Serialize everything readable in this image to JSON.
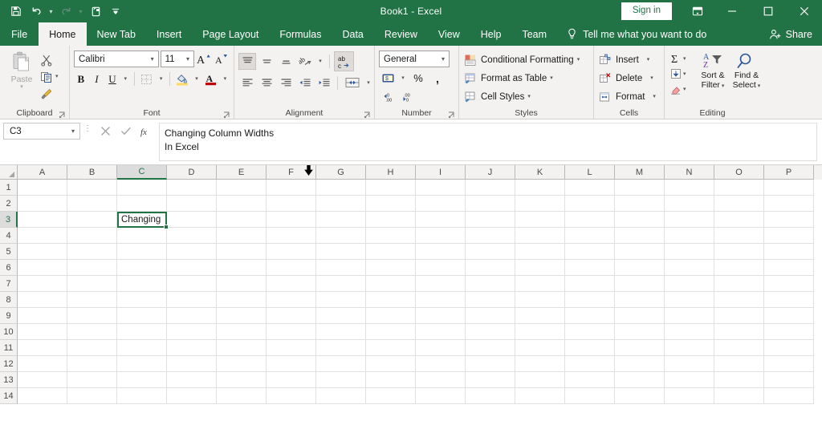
{
  "window": {
    "title": "Book1  -  Excel",
    "signin_label": "Sign in",
    "ribbon_display_icon": "ribbon-display-options-icon",
    "minimize_icon": "minimize-icon",
    "maximize_icon": "maximize-icon",
    "close_icon": "close-icon"
  },
  "quick_access": [
    {
      "name": "save",
      "icon": "save-icon",
      "enabled": true
    },
    {
      "name": "undo",
      "icon": "undo-icon",
      "enabled": true
    },
    {
      "name": "redo",
      "icon": "redo-icon",
      "enabled": false
    },
    {
      "name": "touch-mouse-mode",
      "icon": "touch-mode-icon",
      "enabled": true
    },
    {
      "name": "customize-quick-access-toolbar",
      "icon": "chevron-down-icon",
      "enabled": true
    }
  ],
  "tabs": [
    {
      "label": "File",
      "active": false
    },
    {
      "label": "Home",
      "active": true
    },
    {
      "label": "New Tab",
      "active": false
    },
    {
      "label": "Insert",
      "active": false
    },
    {
      "label": "Page Layout",
      "active": false
    },
    {
      "label": "Formulas",
      "active": false
    },
    {
      "label": "Data",
      "active": false
    },
    {
      "label": "Review",
      "active": false
    },
    {
      "label": "View",
      "active": false
    },
    {
      "label": "Help",
      "active": false
    },
    {
      "label": "Team",
      "active": false
    }
  ],
  "tell_me": {
    "label": "Tell me what you want to do",
    "icon": "lightbulb-icon"
  },
  "share": {
    "label": "Share",
    "icon": "share-person-icon"
  },
  "ribbon": {
    "clipboard": {
      "label": "Clipboard",
      "paste_label": "Paste",
      "cut_label": "Cut",
      "copy_label": "Copy",
      "format_painter_label": "Format Painter",
      "launcher": "dialog-launcher"
    },
    "font": {
      "label": "Font",
      "font_name": "Calibri",
      "font_size": "11",
      "increase_font_label": "A",
      "decrease_font_label": "A",
      "bold_label": "B",
      "italic_label": "I",
      "underline_label": "U",
      "launcher": "dialog-launcher"
    },
    "alignment": {
      "label": "Alignment",
      "launcher": "dialog-launcher"
    },
    "number": {
      "label": "Number",
      "format": "General",
      "percent_label": "%",
      "comma_label": ",",
      "launcher": "dialog-launcher"
    },
    "styles": {
      "label": "Styles",
      "items": [
        {
          "label": "Conditional Formatting",
          "icon": "conditional-formatting-icon"
        },
        {
          "label": "Format as Table",
          "icon": "format-as-table-icon"
        },
        {
          "label": "Cell Styles",
          "icon": "cell-styles-icon"
        }
      ]
    },
    "cells": {
      "label": "Cells",
      "items": [
        {
          "label": "Insert",
          "icon": "insert-cells-icon"
        },
        {
          "label": "Delete",
          "icon": "delete-cells-icon"
        },
        {
          "label": "Format",
          "icon": "format-cells-icon"
        }
      ]
    },
    "editing": {
      "label": "Editing",
      "autosum_label": "Σ",
      "sort_filter_label_line1": "Sort &",
      "sort_filter_label_line2": "Filter",
      "find_select_label_line1": "Find &",
      "find_select_label_line2": "Select"
    }
  },
  "formula_bar": {
    "name_box": "C3",
    "cancel_icon": "cancel-x-icon",
    "enter_icon": "enter-check-icon",
    "insert_function_icon": "fx-icon",
    "content": "Changing Column Widths\nIn Excel"
  },
  "grid": {
    "columns": [
      "A",
      "B",
      "C",
      "D",
      "E",
      "F",
      "G",
      "H",
      "I",
      "J",
      "K",
      "L",
      "M",
      "N",
      "O",
      "P"
    ],
    "rows": [
      "1",
      "2",
      "3",
      "4",
      "5",
      "6",
      "7",
      "8",
      "9",
      "10",
      "11",
      "12",
      "13",
      "14"
    ],
    "selected_cell": "C3",
    "selected_column": "C",
    "selected_row": "3",
    "cell_values": [
      {
        "ref": "C3",
        "value": "Changing"
      }
    ],
    "cursor": {
      "name": "column-select-cursor",
      "over_column": "G"
    }
  },
  "colors": {
    "excel_green": "#217346",
    "ribbon_bg": "#f3f2f1",
    "selection_green": "#217346",
    "accent_red": "#d13438",
    "accent_blue": "#2b579a"
  }
}
